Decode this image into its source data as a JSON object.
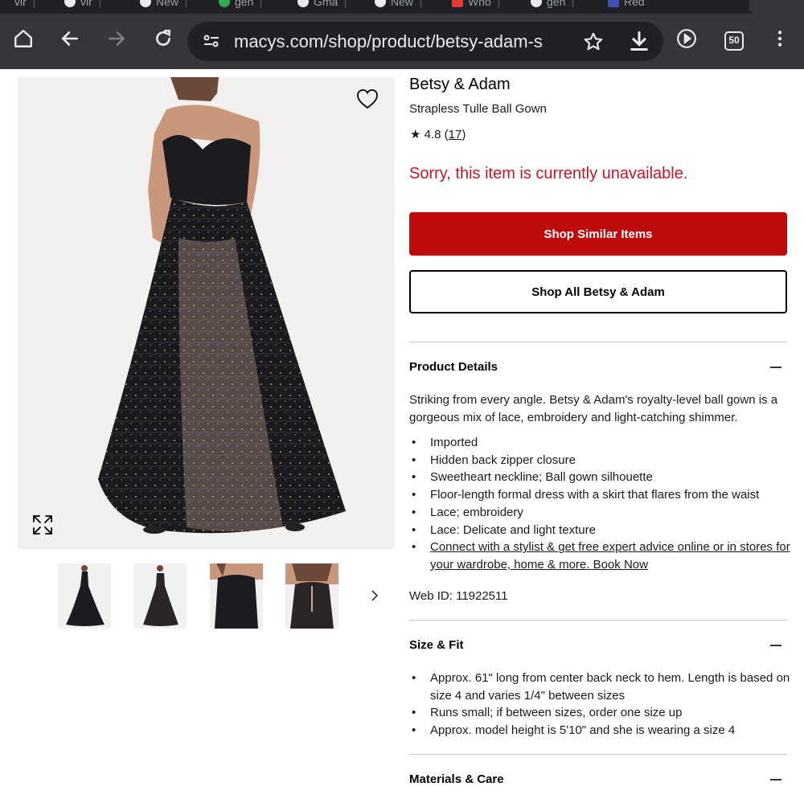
{
  "browser": {
    "url": "macys.com/shop/product/betsy-adam-s",
    "tab_count": "50",
    "tabs": [
      "vir",
      "New",
      "gen",
      "Gma",
      "New",
      "Who",
      "gen",
      "Red"
    ]
  },
  "product": {
    "brand": "Betsy & Adam",
    "name": "Strapless Tulle Ball Gown",
    "rating_star": "★",
    "rating_value": "4.8",
    "rating_count": "17",
    "unavailable_message": "Sorry, this item is currently unavailable.",
    "shop_similar_label": "Shop Similar Items",
    "shop_all_label": "Shop All Betsy & Adam"
  },
  "details": {
    "title": "Product Details",
    "description": "Striking from every angle. Betsy & Adam's royalty-level ball gown is a gorgeous mix of lace, embroidery and light-catching shimmer.",
    "bullets": [
      "Imported",
      "Hidden back zipper closure",
      "Sweetheart neckline; Ball gown silhouette",
      "Floor-length formal dress with a skirt that flares from the waist",
      "Lace; embroidery",
      "Lace: Delicate and light texture"
    ],
    "stylist_link": "Connect with a stylist & get free expert advice online or in stores for your wardrobe, home & more. Book Now",
    "web_id": "Web ID: 11922511"
  },
  "size_fit": {
    "title": "Size & Fit",
    "bullets": [
      "Approx. 61\" long from center back neck to hem. Length is based on size 4 and varies 1/4\" between sizes",
      "Runs small; if between sizes, order one size up",
      "Approx. model height is 5'10\" and she is wearing a size 4"
    ]
  },
  "materials": {
    "title": "Materials & Care"
  },
  "colors": {
    "brand_red": "#bd0a0a",
    "alert_red": "#c0162b",
    "chrome_dark": "#35363a",
    "omnibox": "#202124"
  },
  "icons": [
    "home-icon",
    "back-icon",
    "forward-icon",
    "reload-icon",
    "site-info-icon",
    "star-icon",
    "download-icon",
    "play-icon",
    "heart-icon",
    "expand-icon",
    "chevron-right-icon"
  ]
}
